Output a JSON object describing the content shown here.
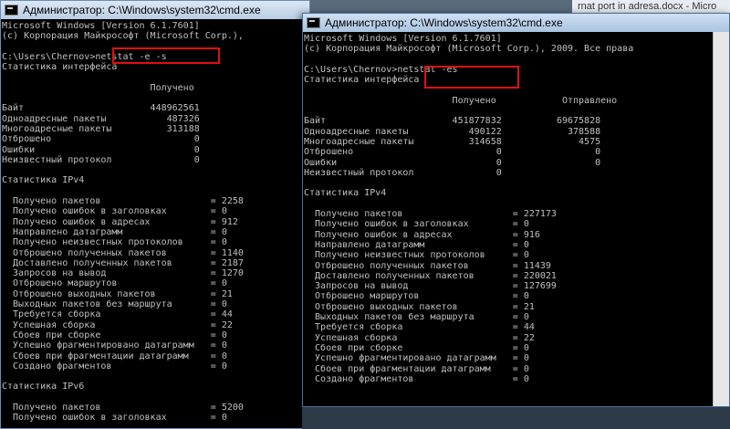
{
  "background_doc": {
    "title_fragment": "rnat port in adresa.docx - Micro"
  },
  "back_window": {
    "title": "Администратор: C:\\Windows\\system32\\cmd.exe",
    "lines": [
      "Microsoft Windows [Version 6.1.7601]",
      "(c) Корпорация Майкрософт (Microsoft Corp.),",
      "",
      "C:\\Users\\Chernov>netstat -e -s",
      "Статистика интерфейса",
      "",
      "                           Получено",
      "",
      "Байт                       448962561",
      "Одноадресные пакеты           487326",
      "Многоадресные пакеты          313188",
      "Отброшено                          0",
      "Ошибки                             0",
      "Неизвестный протокол               0",
      "",
      "Статистика IPv4",
      "",
      "  Получено пакетов                    = 2258",
      "  Получено ошибок в заголовках        = 0",
      "  Получено ошибок в адресах           = 912",
      "  Направлено датаграмм                = 0",
      "  Получено неизвестных протоколов     = 0",
      "  Отброшено полученных пакетов        = 1140",
      "  Доставлено полученных пакетов       = 2187",
      "  Запросов на вывод                   = 1270",
      "  Отброшено маршрутов                 = 0",
      "  Отброшено выходных пакетов          = 21",
      "  Выходных пакетов без маршрута       = 0",
      "  Требуется сборка                    = 44",
      "  Успешная сборка                     = 22",
      "  Сбоев при сборке                    = 0",
      "  Успешно фрагментировано датаграмм   = 0",
      "  Сбоев при фрагментации датаграмм    = 0",
      "  Создано фрагментов                  = 0",
      "",
      "Статистика IPv6",
      "",
      "  Получено пакетов                    = 5200",
      "  Получено ошибок в заголовках        = 0"
    ]
  },
  "front_window": {
    "title": "Администратор: C:\\Windows\\system32\\cmd.exe",
    "lines": [
      "Microsoft Windows [Version 6.1.7601]",
      "(c) Корпорация Майкрософт (Microsoft Corp.), 2009. Все права",
      "",
      "C:\\Users\\Chernov>netstat -es",
      "Статистика интерфейса",
      "",
      "                           Получено            Отправлено",
      "",
      "Байт                       451877832          69675828",
      "Одноадресные пакеты           490122            378588",
      "Многоадресные пакеты          314658              4575",
      "Отброшено                          0                 0",
      "Ошибки                             0                 0",
      "Неизвестный протокол               0",
      "",
      "Статистика IPv4",
      "",
      "  Получено пакетов                    = 227173",
      "  Получено ошибок в заголовках        = 0",
      "  Получено ошибок в адресах           = 916",
      "  Направлено датаграмм                = 0",
      "  Получено неизвестных протоколов     = 0",
      "  Отброшено полученных пакетов        = 11439",
      "  Доставлено полученных пакетов       = 220021",
      "  Запросов на вывод                   = 127699",
      "  Отброшено маршрутов                 = 0",
      "  Отброшено выходных пакетов          = 21",
      "  Выходных пакетов без маршрута       = 0",
      "  Требуется сборка                    = 44",
      "  Успешная сборка                     = 22",
      "  Сбоев при сборке                    = 0",
      "  Успешно фрагментировано датаграмм   = 0",
      "  Сбоев при фрагментации датаграмм    = 0",
      "  Создано фрагментов                  = 0"
    ]
  },
  "colors": {
    "console_bg": "#000000",
    "console_text": "#c0c0c0",
    "highlight": "#e01010"
  },
  "icons": {
    "window_icon": "cmd-icon"
  }
}
